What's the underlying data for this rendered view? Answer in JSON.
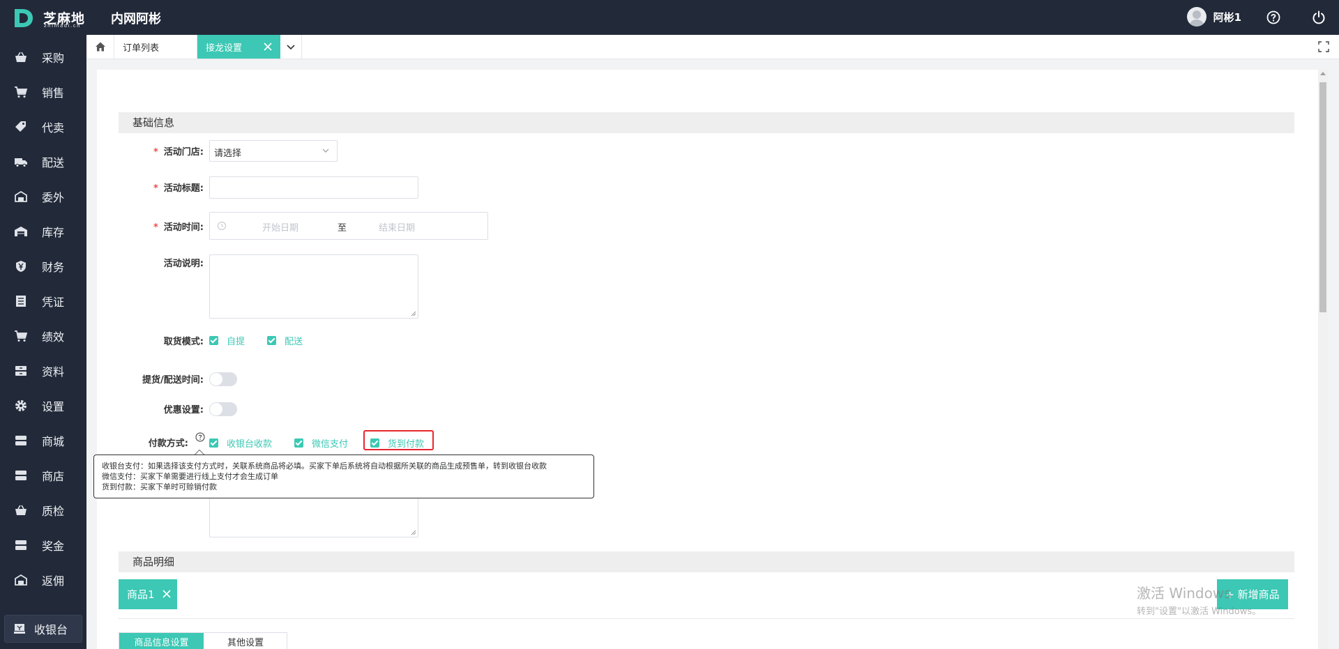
{
  "header": {
    "logo_text": "芝麻地",
    "logo_sub": "zhimadi.cn",
    "app_title": "内网阿彬",
    "username": "阿彬1"
  },
  "sidebar": {
    "items": [
      {
        "label": "采购",
        "icon": "basket-icon"
      },
      {
        "label": "销售",
        "icon": "cart-icon"
      },
      {
        "label": "代卖",
        "icon": "tag-icon"
      },
      {
        "label": "配送",
        "icon": "truck-icon"
      },
      {
        "label": "委外",
        "icon": "building-icon"
      },
      {
        "label": "库存",
        "icon": "warehouse-icon"
      },
      {
        "label": "财务",
        "icon": "yen-shield-icon"
      },
      {
        "label": "凭证",
        "icon": "ledger-icon"
      },
      {
        "label": "绩效",
        "icon": "cart-icon"
      },
      {
        "label": "资料",
        "icon": "archive-icon"
      },
      {
        "label": "设置",
        "icon": "gear-icon"
      },
      {
        "label": "商城",
        "icon": "store-icon"
      },
      {
        "label": "商店",
        "icon": "store-icon"
      },
      {
        "label": "质检",
        "icon": "basket-icon"
      },
      {
        "label": "奖金",
        "icon": "store-icon"
      },
      {
        "label": "返佣",
        "icon": "building-icon"
      }
    ],
    "cashier_label": "收银台"
  },
  "tabs": {
    "orders_label": "订单列表",
    "active_label": "接龙设置"
  },
  "form": {
    "section_basic": "基础信息",
    "store_label": "活动门店:",
    "store_value": "请选择",
    "title_label": "活动标题:",
    "time_label": "活动时间:",
    "start_placeholder": "开始日期",
    "range_sep": "至",
    "end_placeholder": "结束日期",
    "desc_label": "活动说明:",
    "pickup_label": "取货模式:",
    "pickup_options": [
      "自提",
      "配送"
    ],
    "delivery_time_label": "提货/配送时间:",
    "discount_label": "优惠设置:",
    "payment_label": "付款方式:",
    "payment_options": [
      "收银台收款",
      "微信支付",
      "货到付款"
    ]
  },
  "tooltip": {
    "line1": "收银台支付：如果选择该支付方式时，关联系统商品将必填。买家下单后系统将自动根据所关联的商品生成预售单，转到收银台收款",
    "line2": "微信支付：买家下单需要进行线上支付才会生成订单",
    "line3": "货到付款：买家下单时可赊销付款"
  },
  "products": {
    "section_title": "商品明细",
    "tab_label": "商品1",
    "add_button": "+ 新增商品",
    "subtab_info": "商品信息设置",
    "subtab_other": "其他设置"
  },
  "watermark": {
    "line1": "激活 Windows",
    "line2": "转到\"设置\"以激活 Windows。"
  },
  "colors": {
    "accent": "#3cc8b4",
    "sidebar_bg": "#222a3a",
    "highlight": "#e8262d"
  }
}
